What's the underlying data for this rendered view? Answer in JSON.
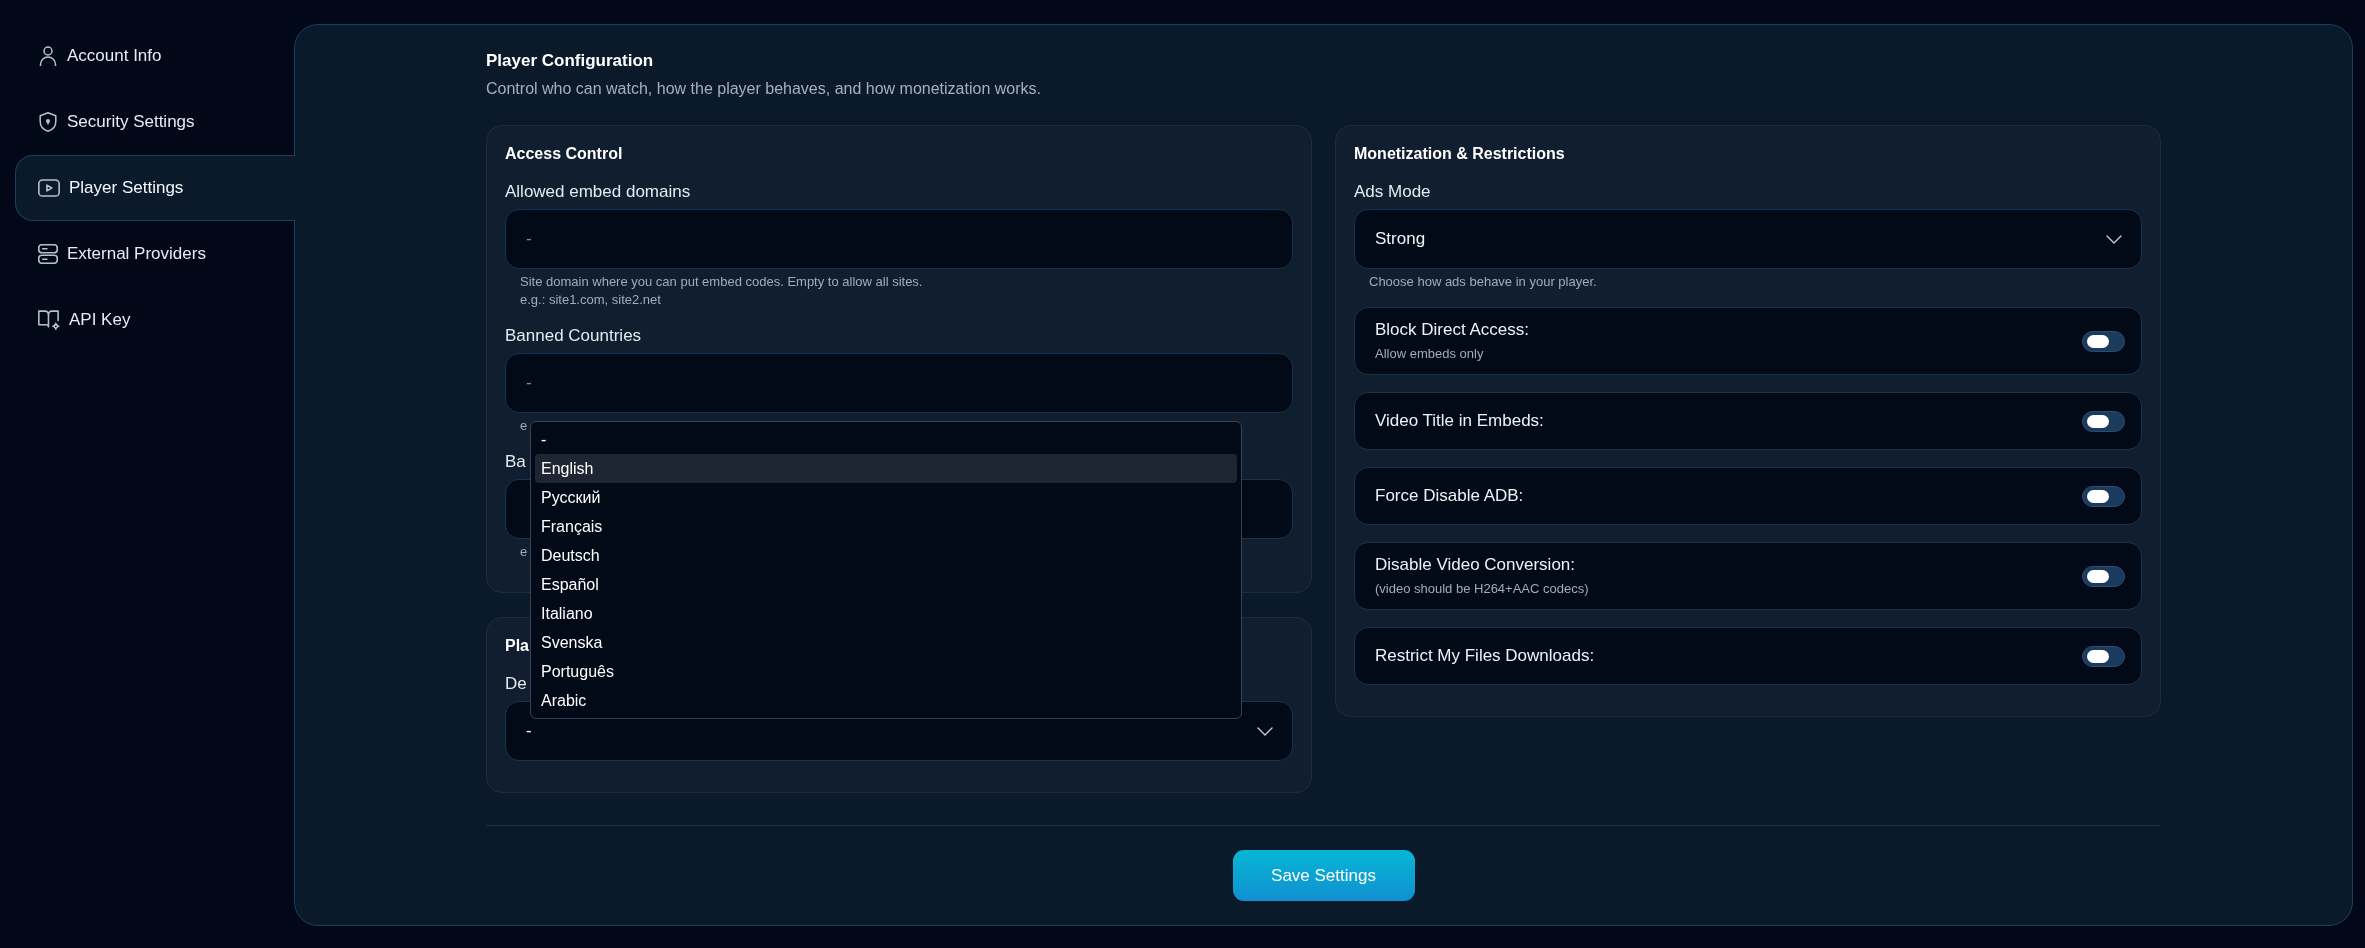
{
  "sidebar": {
    "items": [
      {
        "label": "Account Info",
        "selected": false
      },
      {
        "label": "Security Settings",
        "selected": false
      },
      {
        "label": "Player Settings",
        "selected": true
      },
      {
        "label": "External Providers",
        "selected": false
      },
      {
        "label": "API Key",
        "selected": false
      }
    ]
  },
  "header": {
    "title": "Player Configuration",
    "subtitle": "Control who can watch, how the player behaves, and how monetization works."
  },
  "left_cards": [
    {
      "title": "Access Control",
      "fields": [
        {
          "kind": "text",
          "label": "Allowed embed domains",
          "placeholder": "-",
          "help": [
            "Site domain where you can put embed codes. Empty to allow all sites.",
            "e.g.: site1.com, site2.net"
          ]
        },
        {
          "kind": "text",
          "label": "Banned Countries",
          "placeholder": "-",
          "help": [
            "e"
          ]
        },
        {
          "kind": "text",
          "label": "Ba",
          "help": [
            "e"
          ]
        }
      ]
    },
    {
      "title": "Pla",
      "fields": [
        {
          "kind": "select",
          "label": "De",
          "value": "-"
        }
      ]
    }
  ],
  "monetization": {
    "title": "Monetization & Restrictions",
    "fields": [
      {
        "kind": "select",
        "label": "Ads Mode",
        "value": "Strong",
        "help": [
          "Choose how ads behave in your player."
        ]
      }
    ],
    "toggles": [
      {
        "label": "Block Direct Access:",
        "note": "Allow embeds only",
        "on": false
      },
      {
        "label": "Video Title in Embeds:",
        "on": false
      },
      {
        "label": "Force Disable ADB:",
        "on": false
      },
      {
        "label": "Disable Video Conversion:",
        "note": "(video should be H264+AAC codecs)",
        "on": false
      },
      {
        "label": "Restrict My Files Downloads:",
        "on": false
      }
    ]
  },
  "dropdown": {
    "options": [
      {
        "label": "-",
        "selected": false
      },
      {
        "label": "English",
        "selected": true
      },
      {
        "label": "Русский",
        "selected": false
      },
      {
        "label": "Français",
        "selected": false
      },
      {
        "label": "Deutsch",
        "selected": false
      },
      {
        "label": "Español",
        "selected": false
      },
      {
        "label": "Italiano",
        "selected": false
      },
      {
        "label": "Svenska",
        "selected": false
      },
      {
        "label": "Português",
        "selected": false
      },
      {
        "label": "Arabic",
        "selected": false
      }
    ]
  },
  "save_button": "Save Settings"
}
